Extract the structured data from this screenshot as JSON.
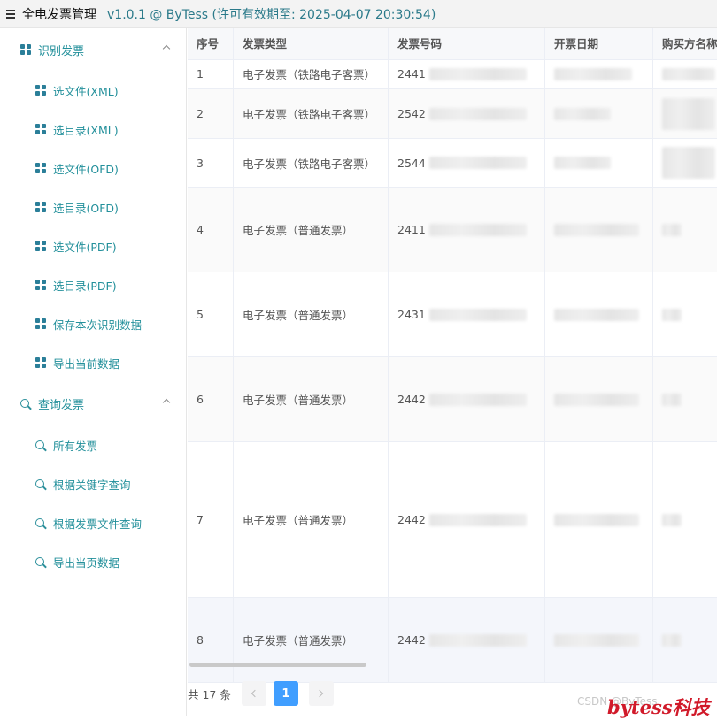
{
  "app": {
    "title": "全电发票管理",
    "version": "v1.0.1 @ ByTess (许可有效期至: 2025-04-07 20:30:54)"
  },
  "sidebar": {
    "groups": [
      {
        "label": "识别发票",
        "icon": "grid-icon",
        "items": [
          {
            "label": "选文件(XML)"
          },
          {
            "label": "选目录(XML)"
          },
          {
            "label": "选文件(OFD)"
          },
          {
            "label": "选目录(OFD)"
          },
          {
            "label": "选文件(PDF)"
          },
          {
            "label": "选目录(PDF)"
          },
          {
            "label": "保存本次识别数据"
          },
          {
            "label": "导出当前数据"
          }
        ]
      },
      {
        "label": "查询发票",
        "icon": "search-icon",
        "items": [
          {
            "label": "所有发票"
          },
          {
            "label": "根据关键字查询"
          },
          {
            "label": "根据发票文件查询"
          },
          {
            "label": "导出当页数据"
          }
        ]
      }
    ]
  },
  "table": {
    "columns": [
      "序号",
      "发票类型",
      "发票号码",
      "开票日期",
      "购买方名称"
    ],
    "rows": [
      {
        "index": "1",
        "type": "电子发票（铁路电子客票）",
        "number_prefix": "2441"
      },
      {
        "index": "2",
        "type": "电子发票（铁路电子客票）",
        "number_prefix": "2542"
      },
      {
        "index": "3",
        "type": "电子发票（铁路电子客票）",
        "number_prefix": "2544"
      },
      {
        "index": "4",
        "type": "电子发票（普通发票）",
        "number_prefix": "2411"
      },
      {
        "index": "5",
        "type": "电子发票（普通发票）",
        "number_prefix": "2431"
      },
      {
        "index": "6",
        "type": "电子发票（普通发票）",
        "number_prefix": "2442"
      },
      {
        "index": "7",
        "type": "电子发票（普通发票）",
        "number_prefix": "2442"
      },
      {
        "index": "8",
        "type": "电子发票（普通发票）",
        "number_prefix": "2442"
      }
    ]
  },
  "pagination": {
    "total": "共 17 条",
    "current_page": "1"
  },
  "watermark": {
    "small": "CSDN @ByTess",
    "big": "bytess科技"
  },
  "colors": {
    "accent": "#23909b",
    "page_active": "#409eff",
    "watermark": "#d11a2a"
  }
}
